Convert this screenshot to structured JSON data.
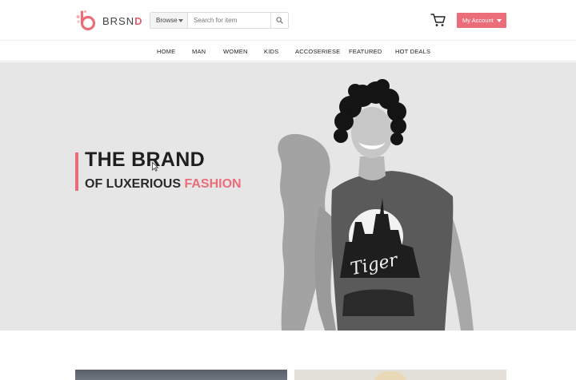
{
  "brand": {
    "name_main": "BRSN",
    "name_accent": "D",
    "accent_color": "#ec6d7a"
  },
  "search": {
    "browse_label": "Browse",
    "placeholder": "Search for item",
    "icon": "search-icon"
  },
  "header": {
    "cart_icon": "cart-icon",
    "account_label": "My Account"
  },
  "nav": {
    "items": [
      "HOME",
      "MAN",
      "WOMEN",
      "KIDS",
      "ACCOSERIESE",
      "FEATURED",
      "HOT DEALS"
    ]
  },
  "hero": {
    "title": "THE BRAND",
    "subtitle_main": "OF LUXERIOUS ",
    "subtitle_accent": "FASHION"
  }
}
